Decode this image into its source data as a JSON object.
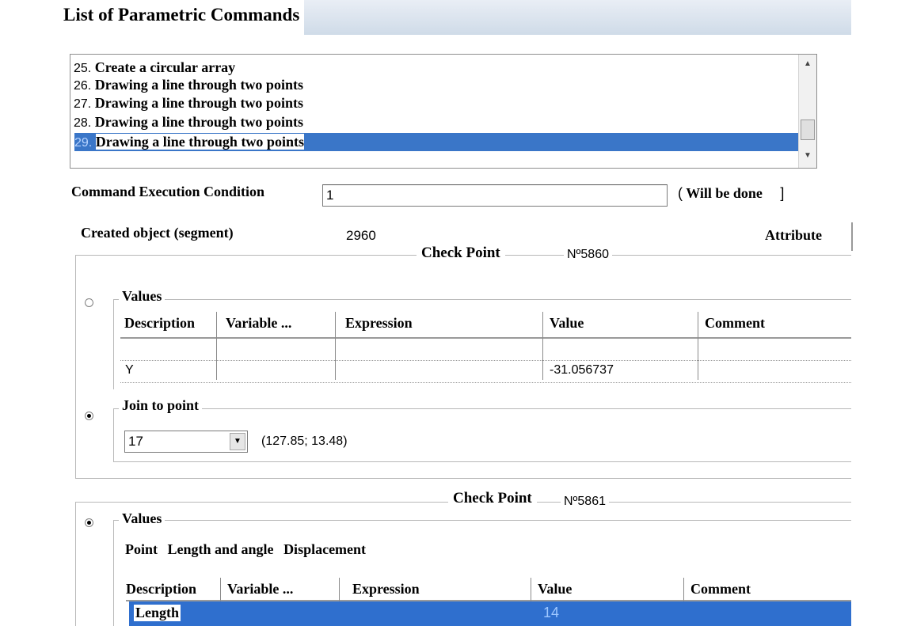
{
  "window": {
    "title": "List of Parametric Commands"
  },
  "command_list": {
    "items": [
      {
        "num": "25.",
        "text": "Create a circular array",
        "selected": false
      },
      {
        "num": "26.",
        "text": "Drawing a line through two points",
        "selected": false
      },
      {
        "num": "27.",
        "text": "Drawing a line through two points",
        "selected": false
      },
      {
        "num": "28.",
        "text": "Drawing a line through two points",
        "selected": false
      },
      {
        "num": "29.",
        "text": "Drawing a line through two points",
        "selected": true
      }
    ],
    "scroll_up_icon": "triangle-up-icon",
    "scroll_down_icon": "triangle-down-icon"
  },
  "condition": {
    "label": "Command Execution Condition",
    "value": "1",
    "status_open": "(",
    "status_text": "Will be done",
    "status_close": "]"
  },
  "created_object": {
    "label": "Created object (segment)",
    "value": "2960",
    "attribute_label": "Attribute"
  },
  "check_point_1": {
    "title": "Check Point",
    "number": "Nº5860",
    "values_group": {
      "label": "Values",
      "columns": [
        "Description",
        "Variable ...",
        "Expression",
        "Value",
        "Comment"
      ],
      "rows": [
        {
          "description": "",
          "variable": "",
          "expression": "",
          "value": "",
          "comment": ""
        },
        {
          "description": "Y",
          "variable": "",
          "expression": "",
          "value": "-31.056737",
          "comment": ""
        }
      ]
    },
    "join_group": {
      "label": "Join to point",
      "selected": "17",
      "coordinates": "(127.85; 13.48)"
    }
  },
  "check_point_2": {
    "title": "Check Point",
    "number": "Nº5861",
    "values_group": {
      "label": "Values",
      "tabs": [
        "Point",
        "Length and angle",
        "Displacement"
      ],
      "columns": [
        "Description",
        "Variable ...",
        "Expression",
        "Value",
        "Comment"
      ],
      "rows": [
        {
          "description": "Length",
          "variable": "",
          "expression": "",
          "value": "14",
          "comment": ""
        }
      ]
    }
  },
  "colors": {
    "selection": "#3a76c8",
    "title_bar": "#cfdbe8"
  }
}
